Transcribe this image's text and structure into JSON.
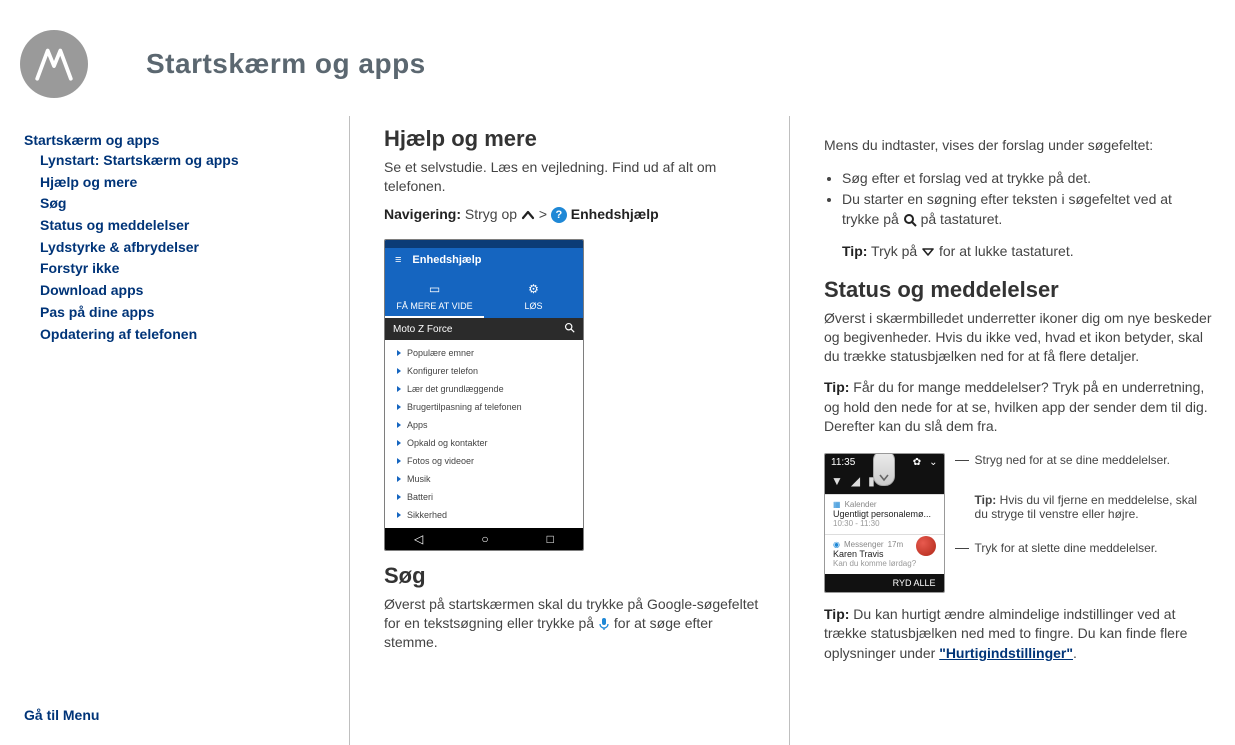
{
  "header": {
    "title": "Startskærm og apps"
  },
  "nav": {
    "section_title": "Startskærm og apps",
    "items": [
      "Lynstart: Startskærm og apps",
      "Hjælp og mere",
      "Søg",
      "Status og meddelelser",
      "Lydstyrke & afbrydelser",
      "Forstyr ikke",
      "Download apps",
      "Pas på dine apps",
      "Opdatering af telefonen"
    ],
    "menu_link": "Gå til Menu"
  },
  "mid": {
    "h1": "Hjælp og mere",
    "p1": "Se et selvstudie. Læs en vejledning. Find ud af alt om telefonen.",
    "nav_label": "Navigering:",
    "nav_text_a": "Stryg op",
    "nav_text_b": ">",
    "nav_text_c": "Enhedshjælp",
    "h2": "Søg",
    "p2a": "Øverst på startskærmen skal du trykke på Google-søgefeltet for en tekstsøgning eller trykke på",
    "p2b": "for at søge efter stemme."
  },
  "phone": {
    "appbar_title": "Enhedshjælp",
    "tab1": "FÅ MERE AT VIDE",
    "tab2": "LØS",
    "search_model": "Moto Z Force",
    "list": [
      "Populære emner",
      "Konfigurer telefon",
      "Lær det grundlæggende",
      "Brugertilpasning af telefonen",
      "Apps",
      "Opkald og kontakter",
      "Fotos og videoer",
      "Musik",
      "Batteri",
      "Sikkerhed"
    ]
  },
  "right": {
    "intro": "Mens du indtaster, vises der forslag under søgefeltet:",
    "bullets": [
      "Søg efter et forslag ved at trykke på det.",
      "Du starter en søgning efter teksten i søgefeltet ved at trykke på"
    ],
    "bullet2_tail": "på tastaturet.",
    "tip1_label": "Tip:",
    "tip1_a": "Tryk på",
    "tip1_b": "for at lukke tastaturet.",
    "h1": "Status og meddelelser",
    "p1": "Øverst i skærmbilledet underretter ikoner dig om nye beskeder og begivenheder. Hvis du ikke ved, hvad et ikon betyder, skal du trække statusbjælken ned for at få flere detaljer.",
    "tip2_label": "Tip:",
    "tip2_text": "Får du for mange meddelelser? Tryk på en underretning, og hold den nede for at se, hvilken app der sender dem til dig. Derefter kan du slå dem fra.",
    "annot1": "Stryg ned for at se dine meddelelser.",
    "annot2_tip": "Tip:",
    "annot2_text": "Hvis du vil fjerne en meddelelse, skal du stryge til venstre eller højre.",
    "annot3": "Tryk for at slette dine meddelelser.",
    "tip3_label": "Tip:",
    "tip3_text": "Du kan hurtigt ændre almindelige indstillinger ved at trække statusbjælken ned med to fingre. Du kan finde flere oplysninger under",
    "tip3_link": "\"Hurtigindstillinger\"",
    "tip3_period": "."
  },
  "notif": {
    "time": "11:35",
    "cal_app": "Kalender",
    "cal_title": "Ugentligt personalemø...",
    "cal_time": "10:30 - 11:30",
    "msg_app": "Messenger",
    "msg_age": "17m",
    "msg_from": "Karen Travis",
    "msg_body": "Kan du komme lørdag?",
    "clear": "RYD ALLE"
  }
}
